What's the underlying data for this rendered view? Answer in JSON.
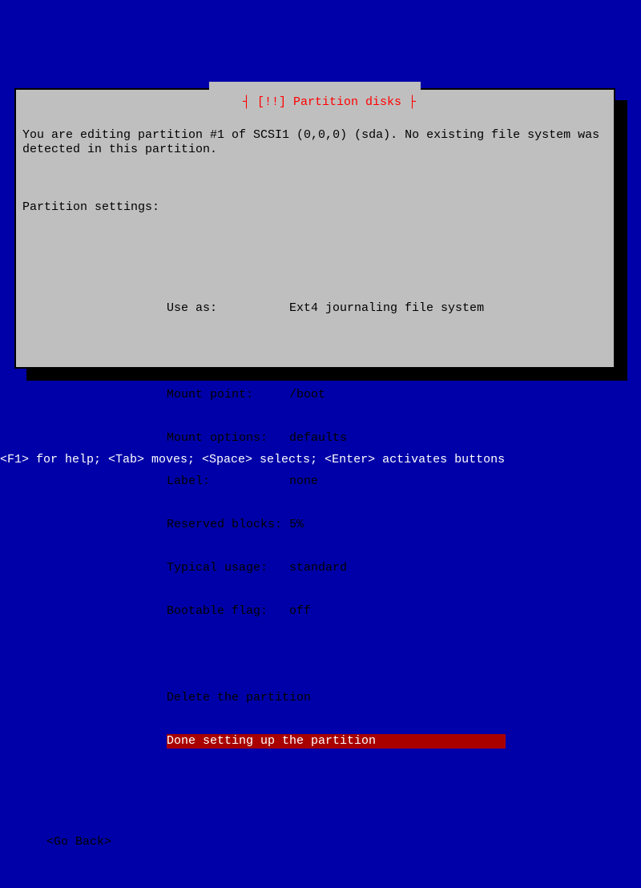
{
  "dialog": {
    "title": "[!!] Partition disks",
    "intro": "You are editing partition #1 of SCSI1 (0,0,0) (sda). No existing file system was detected in this partition.",
    "subhead": "Partition settings:",
    "settings": {
      "use_as": "Use as:          Ext4 journaling file system",
      "mount_point": "Mount point:     /boot",
      "mount_options": "Mount options:   defaults",
      "label": "Label:           none",
      "reserved_blocks": "Reserved blocks: 5%",
      "typical_usage": "Typical usage:   standard",
      "bootable_flag": "Bootable flag:   off"
    },
    "actions": {
      "delete": "Delete the partition",
      "done": "Done setting up the partition                  "
    },
    "goback": "<Go Back>"
  },
  "helpbar": "<F1> for help; <Tab> moves; <Space> selects; <Enter> activates buttons"
}
